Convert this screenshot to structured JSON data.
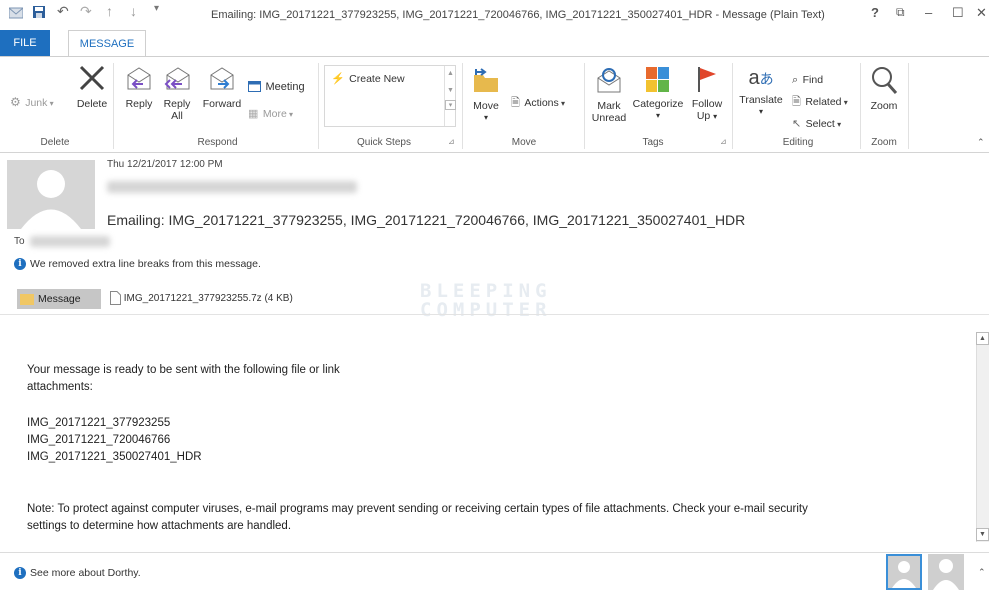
{
  "window": {
    "title": "Emailing: IMG_20171221_377923255, IMG_20171221_720046766, IMG_20171221_350027401_HDR - Message (Plain Text)",
    "controls": [
      "?",
      "⧉",
      "–",
      "☐",
      "✕"
    ]
  },
  "tabs": {
    "file": "FILE",
    "message": "MESSAGE"
  },
  "ribbon": {
    "groups": {
      "delete": "Delete",
      "respond": "Respond",
      "quick_steps": "Quick Steps",
      "move": "Move",
      "tags": "Tags",
      "editing": "Editing",
      "zoom": "Zoom"
    },
    "junk": "Junk",
    "delete_btn": "Delete",
    "reply": "Reply",
    "reply_all_1": "Reply",
    "reply_all_2": "All",
    "forward": "Forward",
    "meeting": "Meeting",
    "more": "More",
    "create_new": "Create New",
    "move_btn": "Move",
    "actions": "Actions",
    "mark_unread_1": "Mark",
    "mark_unread_2": "Unread",
    "categorize": "Categorize",
    "follow_up_1": "Follow",
    "follow_up_2": "Up",
    "translate": "Translate",
    "find": "Find",
    "related": "Related",
    "select": "Select",
    "zoom_btn": "Zoom"
  },
  "message": {
    "date": "Thu 12/21/2017 12:00 PM",
    "subject": "Emailing: IMG_20171221_377923255, IMG_20171221_720046766, IMG_20171221_350027401_HDR",
    "to_label": "To",
    "notice": "We removed extra line breaks from this message.",
    "message_tab": "Message",
    "attachment": "IMG_20171221_377923255.7z (4 KB)",
    "watermark_1": "BLEEPING",
    "watermark_2": "COMPUTER",
    "body": {
      "line1": "Your message is ready to be sent with the following file or link",
      "line2": "attachments:",
      "file1": "IMG_20171221_377923255",
      "file2": "IMG_20171221_720046766",
      "file3": "IMG_20171221_350027401_HDR",
      "note1": "Note: To protect against computer viruses, e-mail programs may prevent sending or receiving certain types of file attachments.  Check your e-mail security",
      "note2": "settings to determine how attachments are handled."
    },
    "see_more": "See more about Dorthy."
  },
  "colors": {
    "accent": "#1e6fbf",
    "follow_flag": "#e0462b"
  }
}
